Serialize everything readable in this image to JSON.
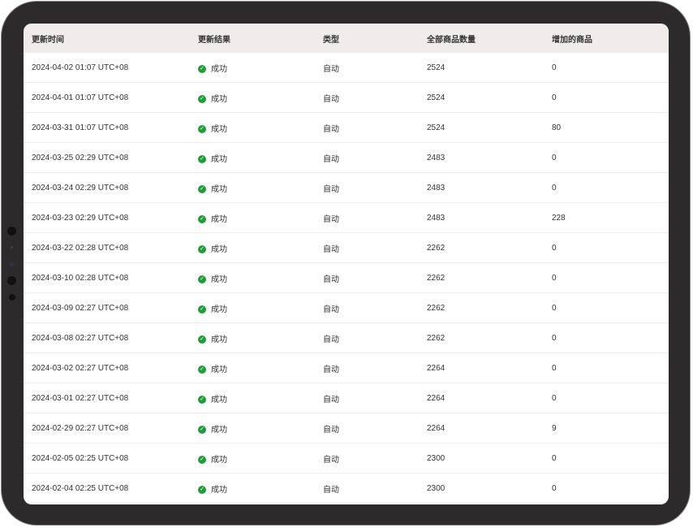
{
  "table": {
    "headers": [
      "更新时间",
      "更新结果",
      "类型",
      "全部商品数量",
      "增加的商品"
    ],
    "rows": [
      {
        "time": "2024-04-02 01:07 UTC+08",
        "result": "成功",
        "type": "自动",
        "total": "2524",
        "added": "0"
      },
      {
        "time": "2024-04-01 01:07 UTC+08",
        "result": "成功",
        "type": "自动",
        "total": "2524",
        "added": "0"
      },
      {
        "time": "2024-03-31 01:07 UTC+08",
        "result": "成功",
        "type": "自动",
        "total": "2524",
        "added": "80"
      },
      {
        "time": "2024-03-25 02:29 UTC+08",
        "result": "成功",
        "type": "自动",
        "total": "2483",
        "added": "0"
      },
      {
        "time": "2024-03-24 02:29 UTC+08",
        "result": "成功",
        "type": "自动",
        "total": "2483",
        "added": "0"
      },
      {
        "time": "2024-03-23 02:29 UTC+08",
        "result": "成功",
        "type": "自动",
        "total": "2483",
        "added": "228"
      },
      {
        "time": "2024-03-22 02:28 UTC+08",
        "result": "成功",
        "type": "自动",
        "total": "2262",
        "added": "0"
      },
      {
        "time": "2024-03-10 02:28 UTC+08",
        "result": "成功",
        "type": "自动",
        "total": "2262",
        "added": "0"
      },
      {
        "time": "2024-03-09 02:27 UTC+08",
        "result": "成功",
        "type": "自动",
        "total": "2262",
        "added": "0"
      },
      {
        "time": "2024-03-08 02:27 UTC+08",
        "result": "成功",
        "type": "自动",
        "total": "2262",
        "added": "0"
      },
      {
        "time": "2024-03-02 02:27 UTC+08",
        "result": "成功",
        "type": "自动",
        "total": "2264",
        "added": "0"
      },
      {
        "time": "2024-03-01 02:27 UTC+08",
        "result": "成功",
        "type": "自动",
        "total": "2264",
        "added": "0"
      },
      {
        "time": "2024-02-29 02:27 UTC+08",
        "result": "成功",
        "type": "自动",
        "total": "2264",
        "added": "9"
      },
      {
        "time": "2024-02-05 02:25 UTC+08",
        "result": "成功",
        "type": "自动",
        "total": "2300",
        "added": "0"
      },
      {
        "time": "2024-02-04 02:25 UTC+08",
        "result": "成功",
        "type": "自动",
        "total": "2300",
        "added": "0"
      }
    ]
  },
  "colors": {
    "success": "#1f9d3a",
    "header_bg": "#f1ecec"
  }
}
